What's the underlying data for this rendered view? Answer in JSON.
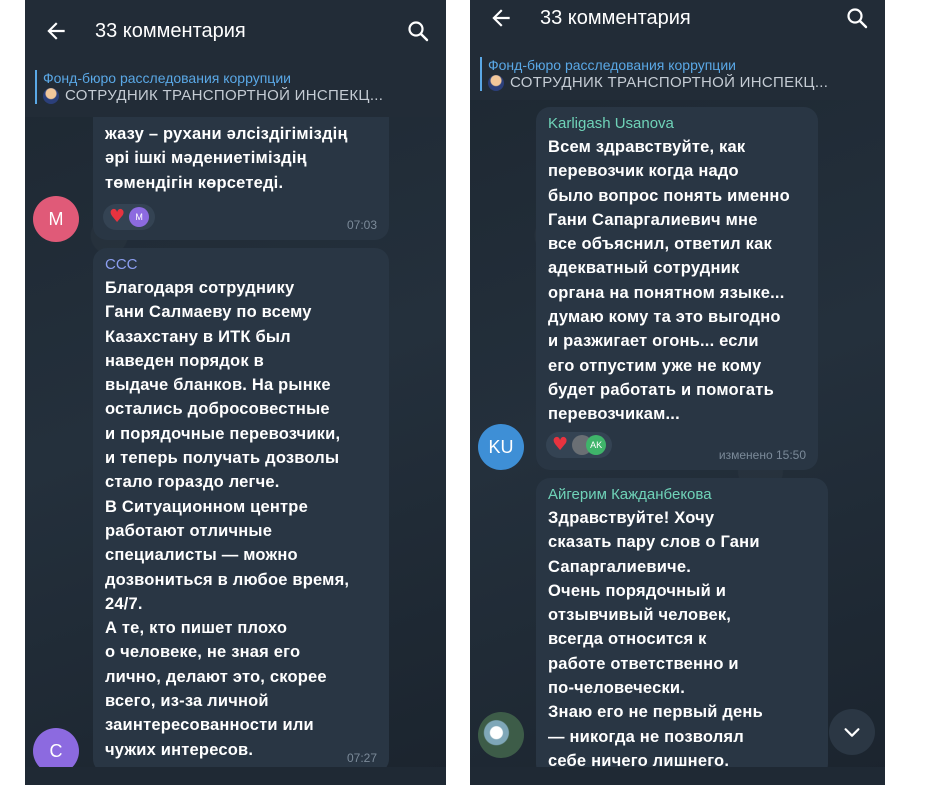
{
  "left": {
    "header": {
      "title": "33 комментария"
    },
    "pinned": {
      "channel": "Фонд-бюро расследования коррупции",
      "text": "СОТРУДНИК ТРАНСПОРТНОЙ ИНСПЕКЦ..."
    },
    "msg1": {
      "lines": [
        "жазу – рухани әлсіздігіміздің",
        "әрі ішкі мәдениетіміздің",
        "төмендігін көрсетеді."
      ],
      "time": "07:03",
      "reaction_avatar": "M",
      "avatar_letter": "M"
    },
    "msg2": {
      "sender": "ССС",
      "lines": [
        "Благодаря сотруднику",
        "Гани Салмаеву по всему",
        "Казахстану в ИТК был",
        "наведен порядок в",
        "выдаче бланков. На рынке",
        "остались добросовестные",
        "и порядочные перевозчики,",
        "и теперь получать дозволы",
        "стало гораздо легче.",
        "В Ситуационном центре",
        "работают отличные",
        "специалисты — можно",
        "дозвониться в любое время,",
        "24/7.",
        "А те, кто пишет плохо",
        "о человеке, не зная его",
        "лично, делают это, скорее",
        "всего, из-за личной",
        "заинтересованности или",
        "чужих интересов."
      ],
      "time": "07:27",
      "avatar_letter": "C"
    }
  },
  "right": {
    "header": {
      "title": "33 комментария"
    },
    "pinned": {
      "channel": "Фонд-бюро расследования коррупции",
      "text": "СОТРУДНИК ТРАНСПОРТНОЙ ИНСПЕКЦ..."
    },
    "msg1": {
      "sender": "Karligash Usanova",
      "lines": [
        "Всем здравствуйте, как",
        "перевозчик когда надо",
        "было вопрос понять  именно",
        "Гани Сапаргалиевич мне",
        "все объяснил, ответил как",
        "адекватный сотрудник",
        "органа на понятном языке...",
        "думаю кому та это выгодно",
        "и разжигает огонь... если",
        "его отпустим уже не кому",
        "будет работать и помогать",
        "перевозчикам..."
      ],
      "time": "изменено 15:50",
      "reaction_avatar": "AK",
      "avatar_letter": "KU"
    },
    "msg2": {
      "sender": "Айгерим Кажданбекова",
      "lines": [
        "Здравствуйте! Хочу",
        "сказать пару слов о Гани",
        "Сапаргалиевиче.",
        "Очень порядочный и",
        "отзывчивый человек,",
        "всегда относится к",
        "работе ответственно и",
        "по-человечески.",
        "Знаю его не первый день",
        "— никогда не позволял",
        "себе ничего лишнего."
      ]
    }
  },
  "colors": {
    "background": "#1f2833",
    "bubble": "#293644",
    "accent": "#5aa8e6",
    "sender_green": "#6fd3b8",
    "sender_blue": "#5aa8e6",
    "avatar_m": "#e05a78",
    "avatar_c": "#8c6ae0",
    "avatar_ku": "#3e8fd6"
  }
}
